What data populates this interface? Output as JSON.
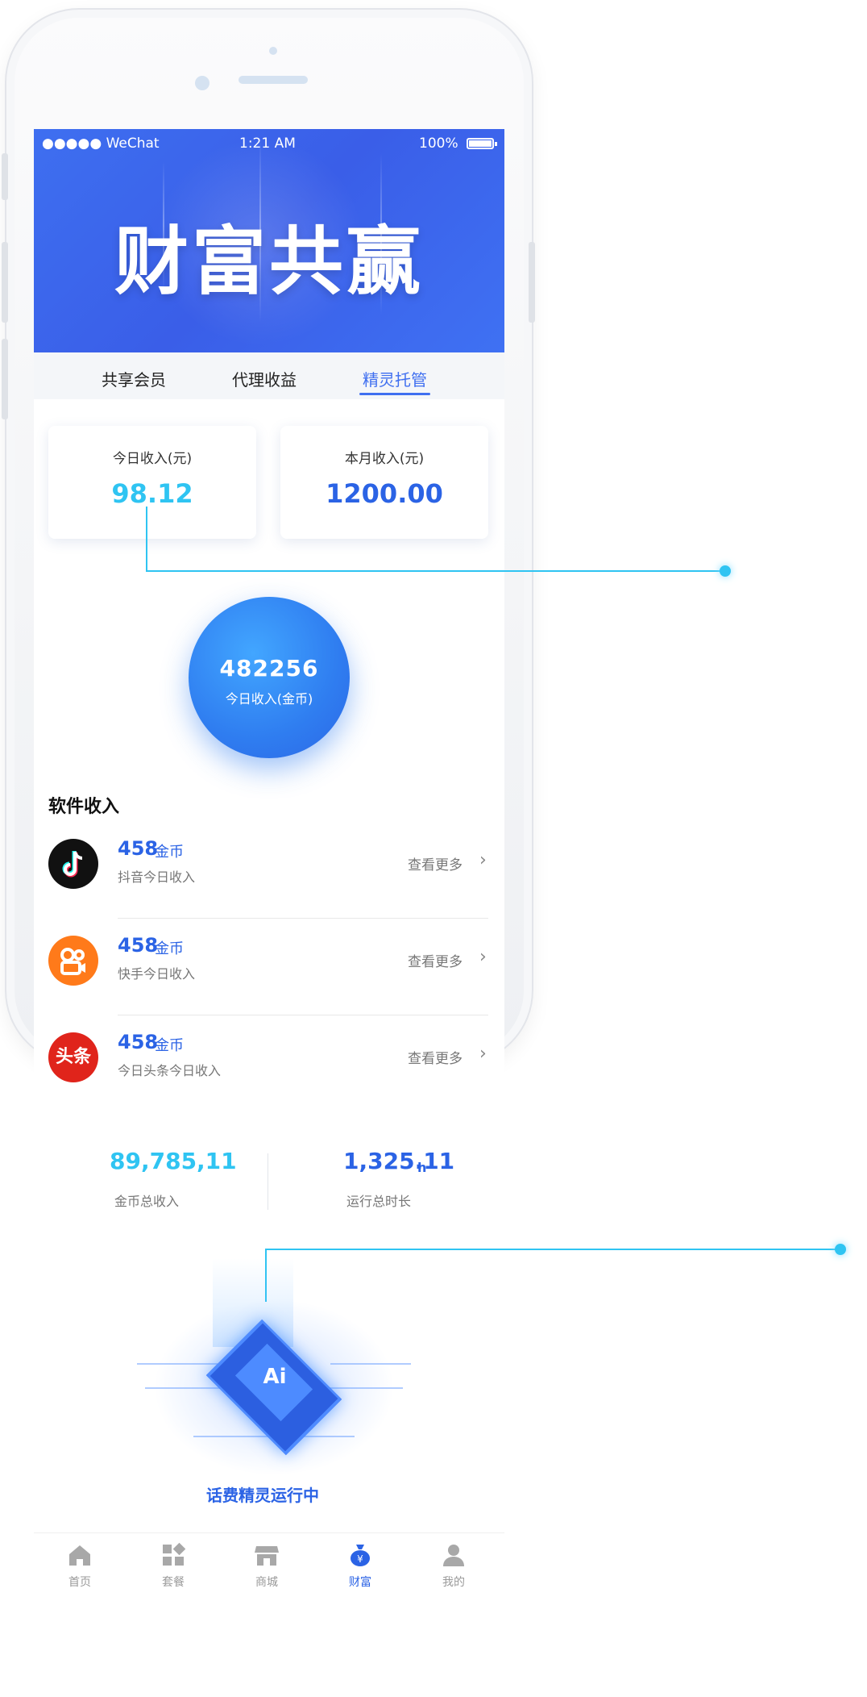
{
  "status": {
    "carrier": "●●●●● WeChat",
    "time": "1:21 AM",
    "battery": "100%"
  },
  "hero": {
    "title": "财富共赢"
  },
  "tabs": [
    {
      "label": "共享会员"
    },
    {
      "label": "代理收益"
    },
    {
      "label": "精灵托管",
      "active": true
    }
  ],
  "income": {
    "today_label": "今日收入(元)",
    "today_value": "98.12",
    "month_label": "本月收入(元)",
    "month_value": "1200.00"
  },
  "coins": {
    "value": "482256",
    "label": "今日收入(金币)"
  },
  "software": {
    "title": "软件收入",
    "items": [
      {
        "amount": "458",
        "unit": "金币",
        "desc": "抖音今日收入",
        "more": "查看更多",
        "icon": "tiktok-icon"
      },
      {
        "amount": "458",
        "unit": "金币",
        "desc": "快手今日收入",
        "more": "查看更多",
        "icon": "kuaishou-icon"
      },
      {
        "amount": "458",
        "unit": "金币",
        "desc": "今日头条今日收入",
        "more": "查看更多",
        "icon": "toutiao-icon",
        "logo_text": "头条"
      }
    ]
  },
  "stats": {
    "coins_total": "89,785,11",
    "coins_total_label": "金币总收入",
    "runtime_total": "1,325.11",
    "runtime_unit": "h",
    "runtime_label": "运行总时长"
  },
  "ai": {
    "chip_text": "Ai",
    "status": "话费精灵运行中"
  },
  "nav": [
    {
      "label": "首页",
      "icon": "home-icon"
    },
    {
      "label": "套餐",
      "icon": "grid-icon"
    },
    {
      "label": "商城",
      "icon": "shop-icon"
    },
    {
      "label": "财富",
      "icon": "wealth-icon",
      "active": true
    },
    {
      "label": "我的",
      "icon": "user-icon"
    }
  ],
  "colors": {
    "primary": "#2b63e5",
    "accent": "#2fc4f2",
    "hero": "#3e6ff0"
  }
}
